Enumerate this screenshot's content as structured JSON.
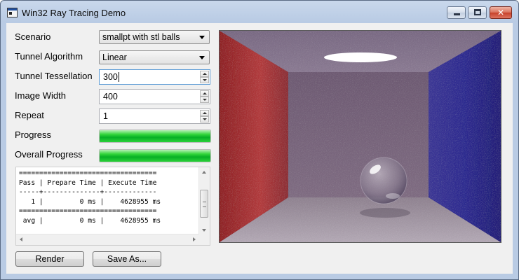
{
  "window": {
    "title": "Win32 Ray Tracing Demo",
    "close_glyph": "✕"
  },
  "form": {
    "scenario": {
      "label": "Scenario",
      "value": "smallpt with stl balls"
    },
    "tunnel_algorithm": {
      "label": "Tunnel Algorithm",
      "value": "Linear"
    },
    "tunnel_tessellation": {
      "label": "Tunnel Tessellation",
      "value": "300"
    },
    "image_width": {
      "label": "Image Width",
      "value": "400"
    },
    "repeat": {
      "label": "Repeat",
      "value": "1"
    },
    "progress": {
      "label": "Progress",
      "value": 1.0
    },
    "overall_progress": {
      "label": "Overall Progress",
      "value": 1.0
    }
  },
  "console": {
    "lines": [
      "==================================",
      "Pass | Prepare Time | Execute Time",
      "-----+--------------+-------------",
      "   1 |         0 ms |    4628955 ms",
      "==================================",
      " avg |         0 ms |    4628955 ms"
    ]
  },
  "buttons": {
    "render": "Render",
    "save_as": "Save As..."
  },
  "colors": {
    "progress_green": "#06b025",
    "accent": "#5b9bd5"
  },
  "icons": [
    "app-icon",
    "minimize-icon",
    "maximize-icon",
    "close-icon"
  ]
}
